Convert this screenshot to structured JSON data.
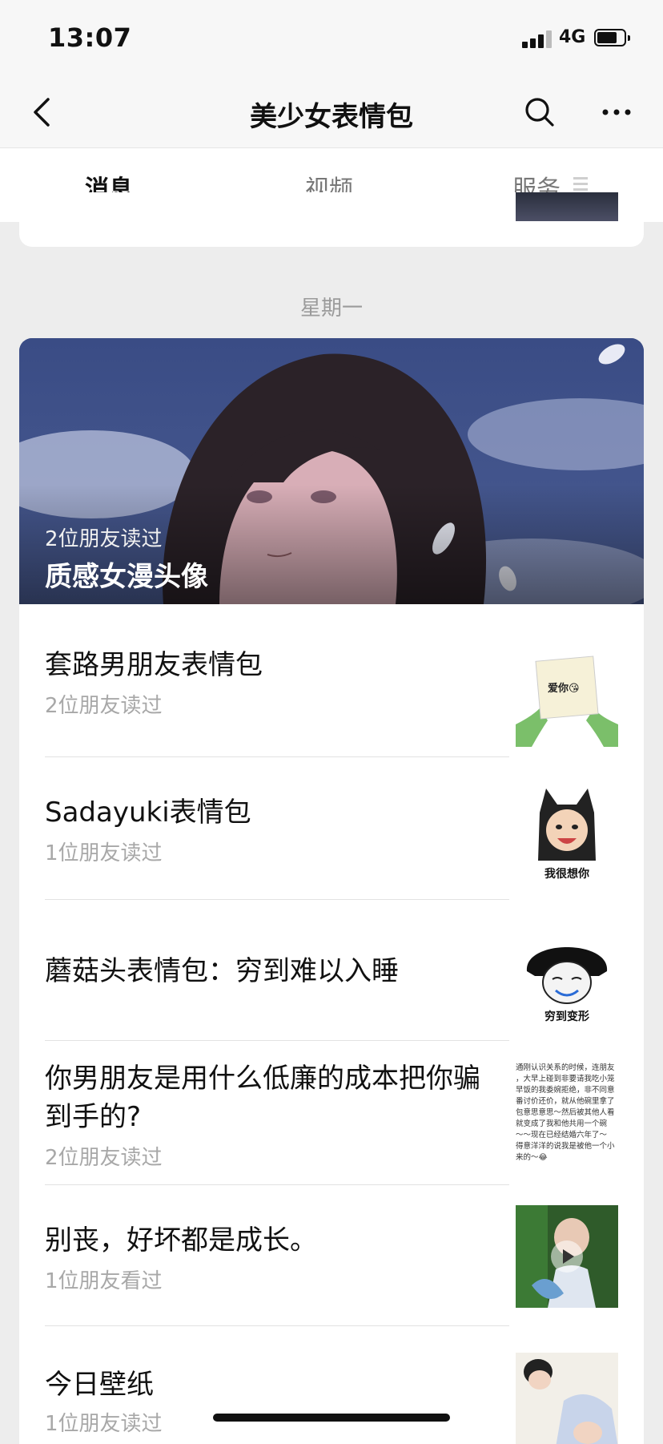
{
  "status_bar": {
    "time": "13:07",
    "network": "4G"
  },
  "nav": {
    "title": "美少女表情包"
  },
  "tabs": [
    {
      "label": "消息",
      "active": true
    },
    {
      "label": "视频",
      "active": false
    },
    {
      "label": "服务",
      "active": false
    }
  ],
  "date_label": "星期一",
  "hero": {
    "readers": "2位朋友读过",
    "title": "质感女漫头像"
  },
  "items": [
    {
      "title": "套路男朋友表情包",
      "sub": "2位朋友读过",
      "thumb_caption": "爱你😘"
    },
    {
      "title": "Sadayuki表情包",
      "sub": "1位朋友读过",
      "thumb_caption": "我很想你"
    },
    {
      "title": "蘑菇头表情包：穷到难以入睡",
      "sub": "",
      "thumb_caption": "穷到变形"
    },
    {
      "title": "你男朋友是用什么低廉的成本把你骗到手的?",
      "sub": "2位朋友读过",
      "thumb_text": [
        "通刚认识关系的时候，连朋友",
        "，大早上碰到非要请我吃小笼",
        "早饭的我委婉拒绝，非不同意",
        "番讨价还价，就从他碗里拿了",
        "包意思意思～然后被其他人看",
        "就变成了我和他共用一个碗",
        "～～现在已经结婚六年了～",
        "得意洋洋的说我是被他一个小",
        "来的～😂"
      ]
    },
    {
      "title": "别丧，好坏都是成长。",
      "sub": "1位朋友看过"
    },
    {
      "title": "今日壁纸",
      "sub": "1位朋友读过"
    }
  ],
  "colors": {
    "accent": "#111111",
    "muted": "#a8a8a8",
    "page_bg": "#ededed"
  }
}
